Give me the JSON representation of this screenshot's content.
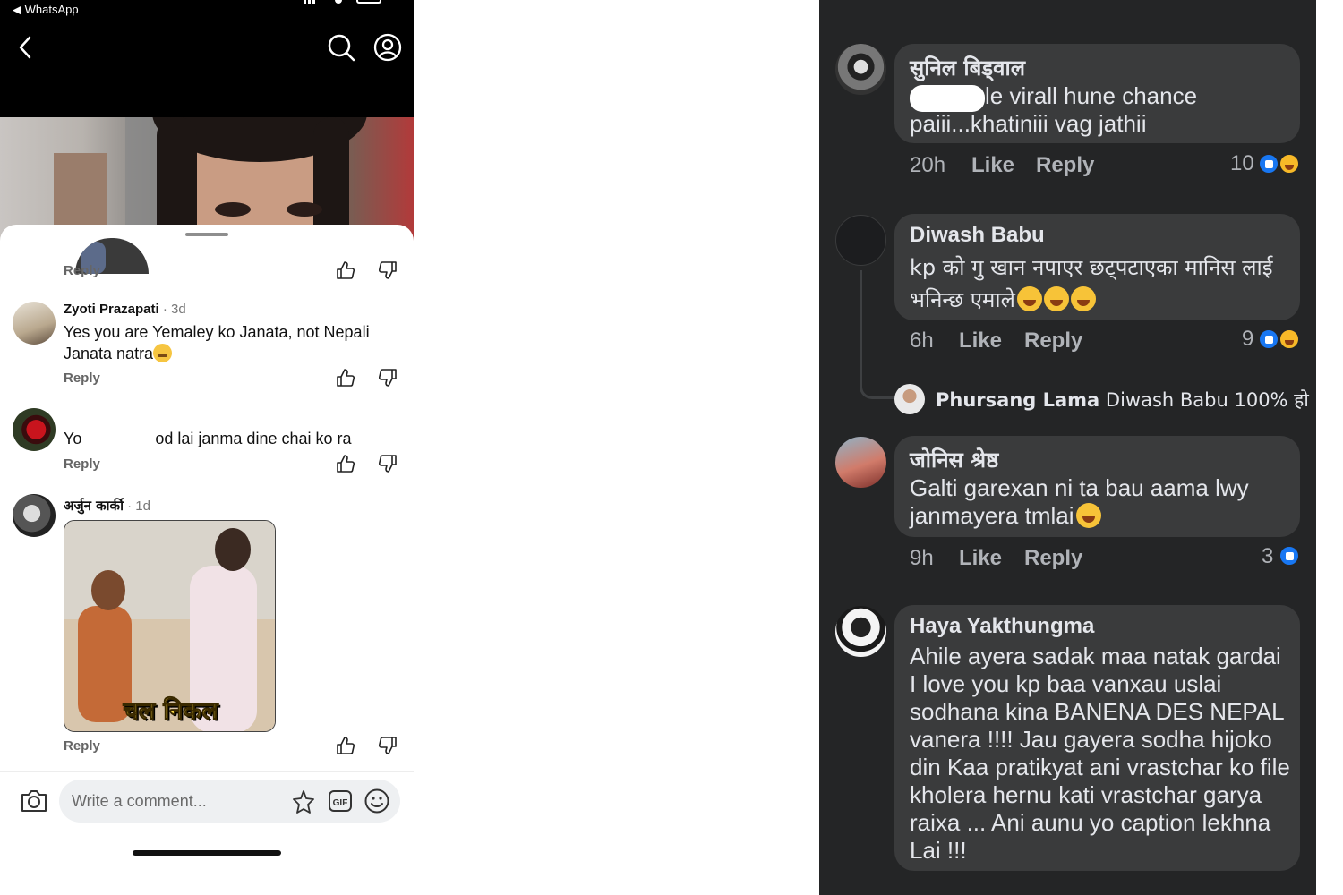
{
  "left": {
    "status_back": "◀ WhatsApp",
    "partial_comment": {
      "reply": "Reply"
    },
    "comments": [
      {
        "name": "Zyoti Prazapati",
        "age": "· 3d",
        "text": "Yes you are Yemaley ko Janata, not Nepali Janata natra",
        "reply": "Reply"
      },
      {
        "name": "",
        "age": "",
        "text_prefix": "Yo",
        "text_suffix": "od lai janma dine chai ko ra",
        "reply": "Reply"
      },
      {
        "name": "अर्जुन कार्की",
        "age": "· 1d",
        "media_caption": "चल निकल",
        "reply": "Reply"
      }
    ],
    "composer": {
      "placeholder": "Write a comment..."
    }
  },
  "right": {
    "comments": [
      {
        "name": "सुनिल बिड्वाल",
        "text": "le virall hune chance paiii...khatiniii vag jathii",
        "time": "20h",
        "like": "Like",
        "reply": "Reply",
        "reactions": "10"
      },
      {
        "name": "Diwash Babu",
        "text": "kp को गु खान नपाएर छट्पटाएका मानिस लाई भनिन्छ एमाले",
        "time": "6h",
        "like": "Like",
        "reply": "Reply",
        "reactions": "9"
      },
      {
        "name": "Phursang Lama",
        "text": "Diwash Babu 100% हो"
      },
      {
        "name": "जोनिस श्रेष्ठ",
        "text": "Galti garexan ni ta bau aama lwy janmayera tmlai",
        "time": "9h",
        "like": "Like",
        "reply": "Reply",
        "reactions": "3"
      },
      {
        "name": "Haya Yakthungma",
        "text": "Ahile ayera sadak maa natak gardai I love you kp baa vanxau uslai sodhana kina BANENA DES NEPAL vanera !!!!  Jau gayera sodha hijoko din Kaa pratikyat ani vrastchar ko file kholera hernu kati vrastchar garya raixa ... Ani aunu yo caption lekhna Lai !!!"
      }
    ]
  }
}
